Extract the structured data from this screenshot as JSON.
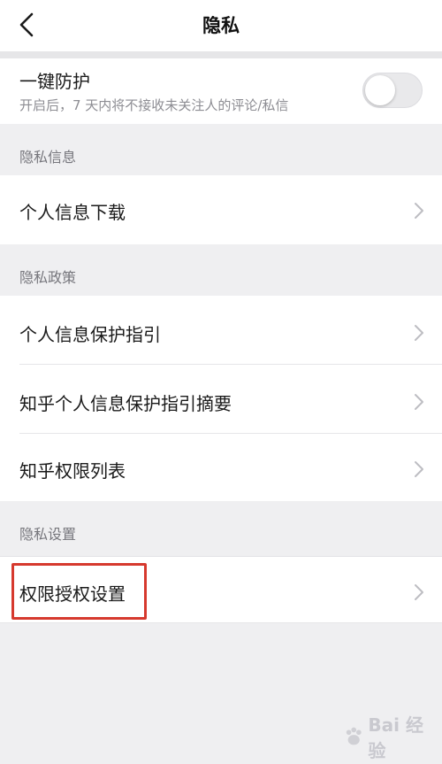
{
  "header": {
    "title": "隐私"
  },
  "protection": {
    "title": "一键防护",
    "description": "开启后，7 天内将不接收未关注人的评论/私信",
    "enabled": false
  },
  "sections": [
    {
      "title": "隐私信息",
      "items": [
        {
          "label": "个人信息下载"
        }
      ]
    },
    {
      "title": "隐私政策",
      "items": [
        {
          "label": "个人信息保护指引"
        },
        {
          "label": "知乎个人信息保护指引摘要"
        },
        {
          "label": "知乎权限列表"
        }
      ]
    },
    {
      "title": "隐私设置",
      "items": [
        {
          "label": "权限授权设置"
        }
      ]
    }
  ],
  "watermark": {
    "text": "Bai  经验"
  }
}
